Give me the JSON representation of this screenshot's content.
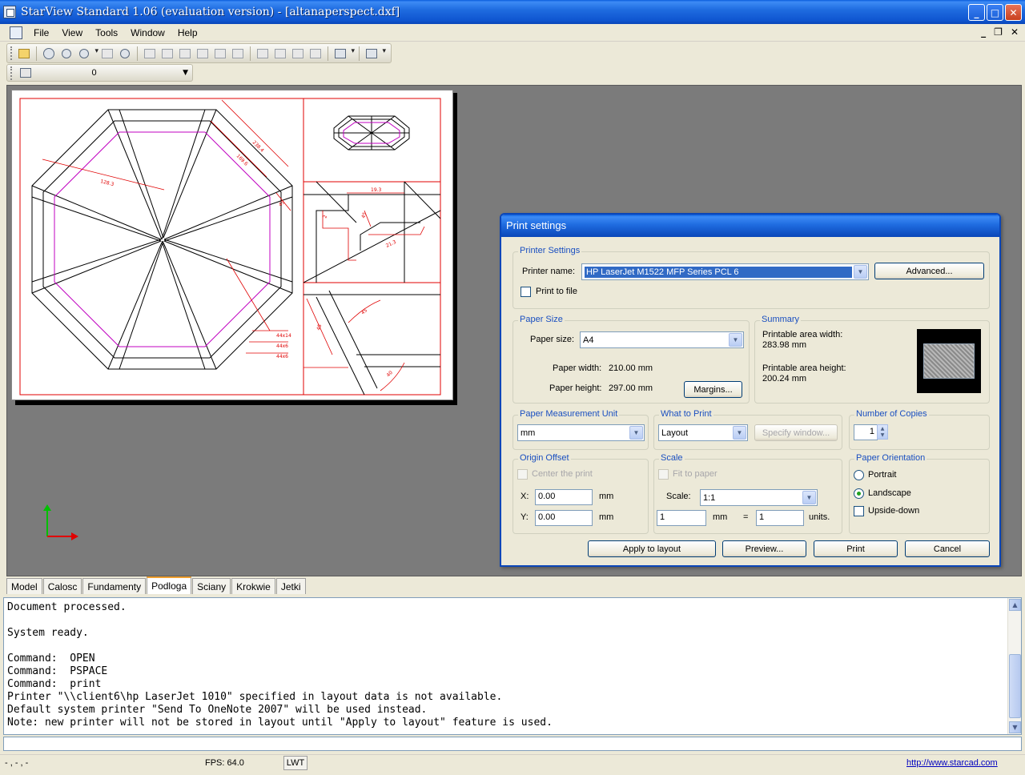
{
  "window": {
    "title": "StarView Standard 1.06 (evaluation version) - [altanaperspect.dxf]",
    "minimize_glyph": "_",
    "maximize_glyph": "□",
    "close_glyph": "✕"
  },
  "menu": {
    "items": [
      "File",
      "View",
      "Tools",
      "Window",
      "Help"
    ],
    "mdi_minimize": "_",
    "mdi_restore": "❐",
    "mdi_close": "✕"
  },
  "toolbar": {
    "icons": [
      "open-icon",
      "pan-icon",
      "zoom-realtime-icon",
      "zoom-window-icon",
      "orbit-icon",
      "undo-view-icon",
      "view-front-icon",
      "view-back-icon",
      "view-left-icon",
      "view-right-icon",
      "view-top-icon",
      "view-bottom-icon",
      "iso-sw-icon",
      "iso-se-icon",
      "iso-ne-icon",
      "iso-nw-icon",
      "shading-icon",
      "view-cube-icon"
    ],
    "layer_value": "0"
  },
  "drawing": {
    "dimensions": [
      "238.4",
      "169.6",
      "128.3",
      "45",
      "44x14",
      "44x6",
      "44x6",
      "19.3",
      "2",
      "45",
      "21.3",
      "45",
      "45",
      "40"
    ]
  },
  "tabs": {
    "items": [
      "Model",
      "Calosc",
      "Fundamenty",
      "Podloga",
      "Sciany",
      "Krokwie",
      "Jetki"
    ],
    "active": "Podloga"
  },
  "console": {
    "text": "Document processed.\n\nSystem ready.\n\nCommand:  OPEN\nCommand:  PSPACE\nCommand:  print\nPrinter \"\\\\client6\\hp LaserJet 1010\" specified in layout data is not available.\nDefault system printer \"Send To OneNote 2007\" will be used instead.\nNote: new printer will not be stored in layout until \"Apply to layout\" feature is used."
  },
  "status": {
    "coords": "- , - , -",
    "fps": "FPS: 64.0",
    "lwt": "LWT",
    "link": "http://www.starcad.com"
  },
  "dialog": {
    "title": "Print settings",
    "printer_settings": {
      "legend": "Printer Settings",
      "printer_name_label": "Printer name:",
      "printer_name_value": "HP LaserJet M1522 MFP Series PCL 6",
      "advanced_label": "Advanced...",
      "print_to_file_label": "Print to file",
      "print_to_file_checked": false
    },
    "paper_size": {
      "legend": "Paper Size",
      "label": "Paper size:",
      "value": "A4",
      "width_label": "Paper width:",
      "width_value": "210.00  mm",
      "height_label": "Paper height:",
      "height_value": "297.00  mm",
      "margins_label": "Margins..."
    },
    "summary": {
      "legend": "Summary",
      "width_label": "Printable area width:",
      "width_value": "283.98  mm",
      "height_label": "Printable area height:",
      "height_value": "200.24  mm"
    },
    "measurement_unit": {
      "legend": "Paper Measurement Unit",
      "value": "mm"
    },
    "what_to_print": {
      "legend": "What to Print",
      "value": "Layout",
      "specify_label": "Specify window..."
    },
    "copies": {
      "legend": "Number of Copies",
      "value": "1"
    },
    "origin_offset": {
      "legend": "Origin Offset",
      "center_label": "Center the print",
      "x_label": "X:",
      "x_value": "0.00",
      "y_label": "Y:",
      "y_value": "0.00",
      "unit": "mm"
    },
    "scale": {
      "legend": "Scale",
      "fit_label": "Fit to paper",
      "scale_label": "Scale:",
      "scale_value": "1:1",
      "mm_value": "1",
      "mm_label": "mm",
      "equals": "=",
      "units_value": "1",
      "units_label": "units."
    },
    "orientation": {
      "legend": "Paper Orientation",
      "portrait": "Portrait",
      "landscape": "Landscape",
      "upside_down": "Upside-down",
      "selected": "Landscape"
    },
    "buttons": {
      "apply": "Apply to layout",
      "preview": "Preview...",
      "print": "Print",
      "cancel": "Cancel"
    }
  },
  "colors": {
    "title_blue": "#0a5ddc",
    "drawing_red": "#e00000",
    "drawing_magenta": "#c000c0",
    "legend_blue": "#1a4fc0",
    "canvas_grey": "#7b7b7b"
  }
}
